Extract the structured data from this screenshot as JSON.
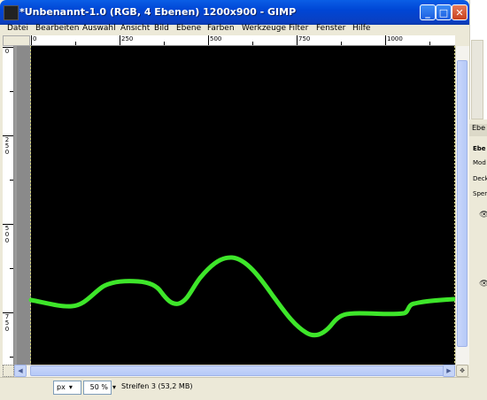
{
  "window": {
    "title": "*Unbenannt-1.0 (RGB, 4 Ebenen) 1200x900 - GIMP",
    "minimize_label": "_",
    "maximize_label": "□",
    "close_label": "✕"
  },
  "menubar": {
    "items": [
      {
        "label": "Datei"
      },
      {
        "label": "Bearbeiten"
      },
      {
        "label": "Auswahl"
      },
      {
        "label": "Ansicht"
      },
      {
        "label": "Bild"
      },
      {
        "label": "Ebene"
      },
      {
        "label": "Farben"
      },
      {
        "label": "Werkzeuge"
      },
      {
        "label": "Filter"
      },
      {
        "label": "Fenster"
      },
      {
        "label": "Hilfe"
      }
    ]
  },
  "rulers": {
    "horizontal": [
      "0",
      "250",
      "500",
      "750",
      "1000"
    ],
    "vertical": [
      "0",
      "250",
      "500",
      "750"
    ]
  },
  "canvas": {
    "background": "#000000",
    "stroke_color": "#3ee62a"
  },
  "statusbar": {
    "unit": "px",
    "zoom": "50 %",
    "status_text": "Streifen 3 (53,2 MB)"
  },
  "dock": {
    "tab_label": "Ebe",
    "row_labels": [
      "Ebe",
      "Mod",
      "Deck",
      "Sper"
    ]
  },
  "icons": {
    "app": "gimp-image-icon",
    "eye": "eye-icon",
    "navigate": "navigate-icon",
    "quickmask": "quick-mask-icon"
  }
}
